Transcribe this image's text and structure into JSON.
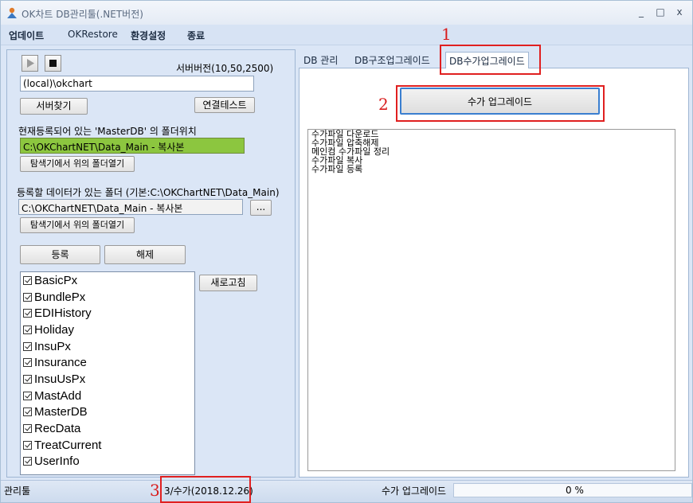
{
  "window": {
    "title": "OK차트 DB관리툴(.NET버전)",
    "min": "_",
    "max": "□",
    "close": "x"
  },
  "menu": [
    "업데이트",
    "OKRestore",
    "환경설정",
    "종료"
  ],
  "left": {
    "server_version": "서버버전(10,50,2500)",
    "server_value": "(local)\\okchart",
    "find_server": "서버찾기",
    "connect_test": "연결테스트",
    "master_label": "현재등록되어 있는 'MasterDB' 의 폴더위치",
    "master_path": "C:\\OKChartNET\\Data_Main - 복사본",
    "open_explorer": "탐색기에서 위의 폴더열기",
    "data_folder_label": "등록할 데이터가 있는 폴더 (기본:C:\\OKChartNET\\Data_Main)",
    "data_path": "C:\\OKChartNET\\Data_Main - 복사본",
    "browse": "...",
    "open_explorer2": "탐색기에서 위의 폴더열기",
    "register": "등록",
    "unregister": "해제",
    "refresh": "새로고침",
    "databases": [
      "BasicPx",
      "BundlePx",
      "EDIHistory",
      "Holiday",
      "InsuPx",
      "Insurance",
      "InsuUsPx",
      "MastAdd",
      "MasterDB",
      "RecData",
      "TreatCurrent",
      "UserInfo"
    ]
  },
  "tabs": [
    "DB 관리",
    "DB구조업그레이드",
    "DB수가업그레이드"
  ],
  "right": {
    "upgrade_button": "수가 업그레이드",
    "log_lines": [
      "수가파일 다운로드",
      "수가파일 압축해제",
      "메인컴 수가파일 정리",
      "수가파일 복사",
      "수가파일 등록"
    ]
  },
  "status": {
    "left": "관리툴",
    "version": "3/수가(2018.12.26)",
    "task": "수가 업그레이드",
    "progress": "0 %"
  },
  "annotations": [
    "1",
    "2",
    "3"
  ],
  "colors": {
    "accent_green": "#8cc63f",
    "annotation_red": "#e02020"
  }
}
